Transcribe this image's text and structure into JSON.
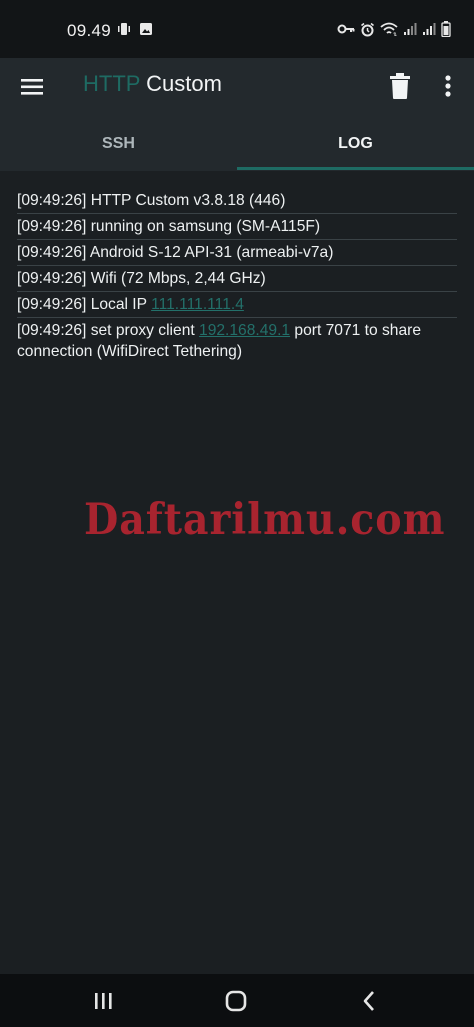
{
  "status_bar": {
    "time": "09.49",
    "left_icons": [
      "vibrate-icon",
      "image-icon"
    ],
    "right_icons": [
      "key-icon",
      "alarm-icon",
      "wifi-icon",
      "signal-icon",
      "signal-icon",
      "battery-icon"
    ]
  },
  "app_bar": {
    "title_accent": "HTTP",
    "title_main": " Custom",
    "icons": [
      "menu-icon",
      "trash-icon",
      "more-vert-icon"
    ]
  },
  "tabs": [
    {
      "label": "SSH",
      "selected": false
    },
    {
      "label": "LOG",
      "selected": true
    }
  ],
  "log": [
    {
      "text": "[09:49:26] HTTP Custom v3.8.18 (446)"
    },
    {
      "text": "[09:49:26] running on samsung (SM-A115F)"
    },
    {
      "text": "[09:49:26] Android S-12 API-31 (armeabi-v7a)"
    },
    {
      "text": "[09:49:26] Wifi (72 Mbps, 2,44 GHz)"
    },
    {
      "prefix": "[09:49:26] Local IP ",
      "link": "111.111.111.4"
    },
    {
      "prefix": "[09:49:26] set proxy client ",
      "link": "192.168.49.1",
      "suffix": " port 7071 to share connection (WifiDirect Tethering)"
    }
  ],
  "watermark": "Daftarilmu.com",
  "colors": {
    "accent": "#1e6b63",
    "background": "#1b1f22",
    "app_bar": "#23292d",
    "watermark": "#a8242f"
  },
  "nav_bar": {
    "icons": [
      "recents-icon",
      "home-icon",
      "back-icon"
    ]
  }
}
